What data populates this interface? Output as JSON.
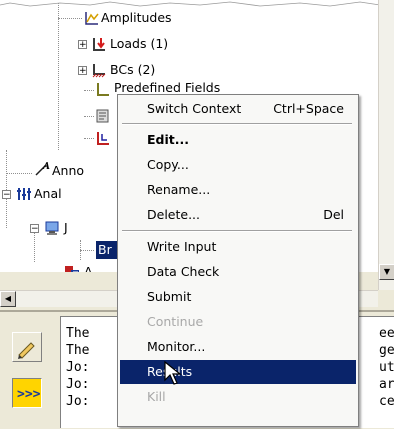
{
  "tree": {
    "items": [
      {
        "label": "Amplitudes",
        "icon": "amplitudes-icon"
      },
      {
        "label": "Loads (1)",
        "icon": "loads-icon"
      },
      {
        "label": "BCs (2)",
        "icon": "bcs-icon"
      },
      {
        "label": "Predefined Fields",
        "icon": "predefined-fields-icon"
      },
      {
        "label": "",
        "icon": "remeshing-icon"
      },
      {
        "label": "",
        "icon": "sketches-icon"
      },
      {
        "label": "Anno",
        "icon": "annotations-icon"
      },
      {
        "label": "Anal",
        "icon": "analysis-icon"
      },
      {
        "label": "J",
        "icon": "jobs-icon"
      },
      {
        "label": "Br",
        "icon": "job-icon",
        "selected": true
      },
      {
        "label": "A",
        "icon": "adaptivity-icon"
      }
    ]
  },
  "context_menu": {
    "items": [
      {
        "label": "Switch Context",
        "shortcut": "Ctrl+Space"
      },
      {
        "label": "Edit..."
      },
      {
        "label": "Copy..."
      },
      {
        "label": "Rename..."
      },
      {
        "label": "Delete...",
        "shortcut": "Del"
      },
      {
        "label": "Write Input"
      },
      {
        "label": "Data Check"
      },
      {
        "label": "Submit"
      },
      {
        "label": "Continue"
      },
      {
        "label": "Monitor..."
      },
      {
        "label": "Results"
      },
      {
        "label": "Kill"
      }
    ]
  },
  "messages": {
    "lines": [
      {
        "left": "The",
        "right": "ee"
      },
      {
        "left": "The",
        "right": "ge"
      },
      {
        "left": "Jo:",
        "right": "ut"
      },
      {
        "left": "Jo:",
        "right": "ar"
      },
      {
        "left": "Jo:",
        "right": "ce"
      }
    ]
  },
  "colors": {
    "selection": "#0a246a",
    "tree_selection": "#0a246a",
    "toolbar_active": "#ffd400",
    "background": "#ece9d8"
  }
}
